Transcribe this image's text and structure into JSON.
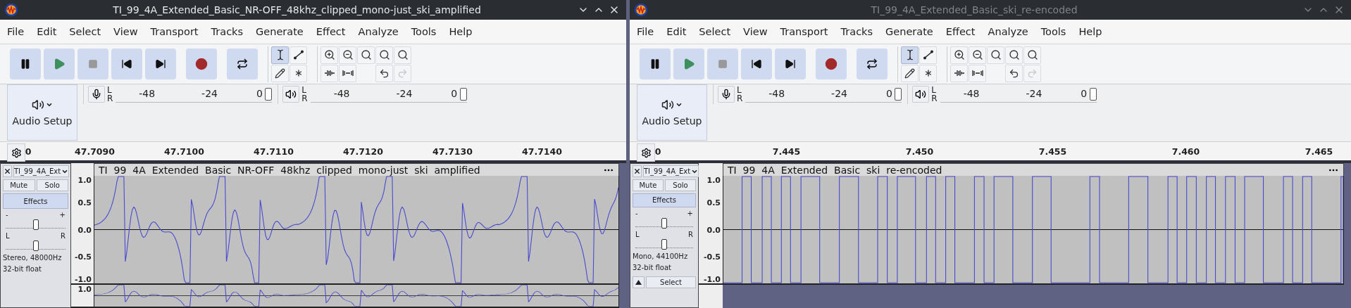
{
  "windows": [
    {
      "title": "TI_99_4A_Extended_Basic_NR-OFF_48khz_clipped_mono-just_ski_amplified",
      "active": true,
      "menu": [
        "File",
        "Edit",
        "Select",
        "View",
        "Transport",
        "Tracks",
        "Generate",
        "Effect",
        "Analyze",
        "Tools",
        "Help"
      ],
      "tools": [
        {
          "kind": "select",
          "selected": true
        },
        {
          "kind": "envelope",
          "selected": false
        },
        {
          "kind": "draw",
          "selected": false
        },
        {
          "kind": "multi",
          "selected": false
        }
      ],
      "history": [
        {
          "kind": "undo",
          "disabled": false
        },
        {
          "kind": "redo",
          "disabled": true
        }
      ],
      "meters": [
        {
          "kind": "record",
          "channels": [
            "L",
            "R"
          ],
          "ticks": [
            "-48",
            "-24",
            "0"
          ],
          "level": 1
        },
        {
          "kind": "playback",
          "channels": [
            "L",
            "R"
          ],
          "ticks": [
            "-48",
            "-24",
            "0"
          ],
          "level": 1
        }
      ],
      "audio_setup": "Audio Setup",
      "ruler": {
        "start": "0",
        "labels": [
          "47.7090",
          "47.7100",
          "47.7110",
          "47.7120",
          "47.7130",
          "47.7140"
        ]
      },
      "track": {
        "name": "TI_99_4A_Ext",
        "mute": "Mute",
        "solo": "Solo",
        "effects": "Effects",
        "gain": {
          "min": "-",
          "max": "+",
          "level": 0.5
        },
        "pan": {
          "left": "L",
          "right": "R",
          "level": 0.5
        },
        "format": [
          "Stereo, 48000Hz",
          "32-bit float"
        ],
        "title": "TI  99  4A  Extended  Basic  NR-OFF  48khz  clipped  mono-just  ski  amplified",
        "kind": "smooth",
        "channels": [
          {
            "y_ticks": [
              "1.0",
              "0.5",
              "0.0",
              "-0.5",
              "-1.0"
            ]
          },
          {
            "y_ticks": [
              "1.0"
            ]
          }
        ]
      }
    },
    {
      "title": "TI_99_4A_Extended_Basic_ski_re-encoded",
      "active": false,
      "menu": [
        "File",
        "Edit",
        "Select",
        "View",
        "Transport",
        "Tracks",
        "Generate",
        "Effect",
        "Analyze",
        "Tools",
        "Help"
      ],
      "tools": [
        {
          "kind": "select",
          "selected": true
        },
        {
          "kind": "envelope",
          "selected": false
        },
        {
          "kind": "draw",
          "selected": false
        },
        {
          "kind": "multi",
          "selected": false
        }
      ],
      "history": [
        {
          "kind": "undo",
          "disabled": false
        },
        {
          "kind": "redo",
          "disabled": true
        }
      ],
      "meters": [
        {
          "kind": "record",
          "channels": [
            "L",
            "R"
          ],
          "ticks": [
            "-48",
            "-24",
            "0"
          ],
          "level": 1
        },
        {
          "kind": "playback",
          "channels": [
            "L",
            "R"
          ],
          "ticks": [
            "-48",
            "-24",
            "0"
          ],
          "level": 1
        }
      ],
      "audio_setup": "Audio Setup",
      "ruler": {
        "start": "0",
        "labels": [
          "7.445",
          "7.450",
          "7.455",
          "7.460",
          "7.465"
        ]
      },
      "track": {
        "name": "TI_99_4A_Ext",
        "mute": "Mute",
        "solo": "Solo",
        "effects": "Effects",
        "gain": {
          "min": "-",
          "max": "+",
          "level": 0.5
        },
        "pan": {
          "left": "L",
          "right": "R",
          "level": 0.5
        },
        "format": [
          "Mono, 44100Hz",
          "32-bit float"
        ],
        "select": "Select",
        "title": "TI  99  4A  Extended  Basic  ski  re-encoded",
        "kind": "square",
        "channels": [
          {
            "y_ticks": [
              "1.0",
              "0.5",
              "0.0",
              "-0.5",
              "-1.0"
            ]
          }
        ]
      }
    }
  ]
}
